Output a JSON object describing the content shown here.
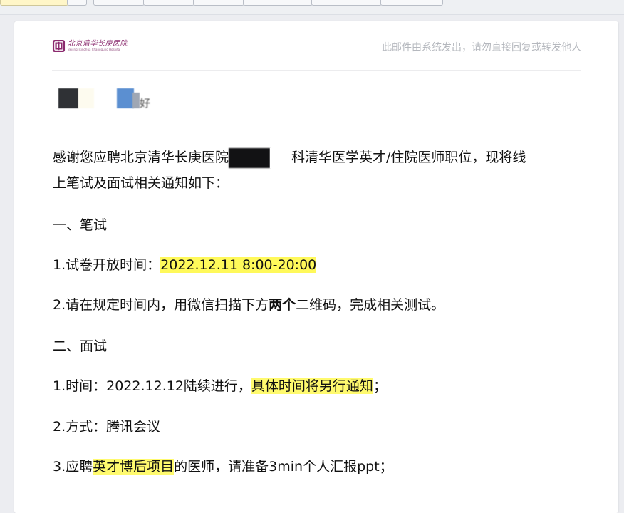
{
  "colors": {
    "highlight": "#fff95a",
    "notice_gray": "#b5b8be",
    "logo_purple": "#8b2a6e"
  },
  "header": {
    "logo_cn": "北京清华长庚医院",
    "logo_en": "Beijing Tsinghua Changgung Hospital",
    "notice": "此邮件由系统发出，请勿直接回复或转发他人"
  },
  "greeting": {
    "suffix": "好"
  },
  "body": {
    "intro_a": "感谢您应聘北京清华长庚医院",
    "intro_b": "科清华医学英才/住院医师职位，现将线",
    "intro_line2": "上笔试及面试相关通知如下：",
    "sec1_title": "一、笔试",
    "s1_item1_label": "1.试卷开放时间：",
    "s1_item1_value": "2022.12.11 8:00-20:00",
    "s1_item2_a": "2.请在规定时间内，用微信扫描下方",
    "s1_item2_bold": "两个",
    "s1_item2_b": "二维码，完成相关测试。",
    "sec2_title": "二、面试",
    "s2_item1_a": "1.时间：2022.12.12陆续进行，",
    "s2_item1_hl": "具体时间将另行通知",
    "s2_item1_b": "；",
    "s2_item2": "2.方式：腾讯会议",
    "s2_item3_a": "3.应聘",
    "s2_item3_hl": "英才博后项目",
    "s2_item3_b": "的医师，请准备3min个人汇报ppt；"
  }
}
